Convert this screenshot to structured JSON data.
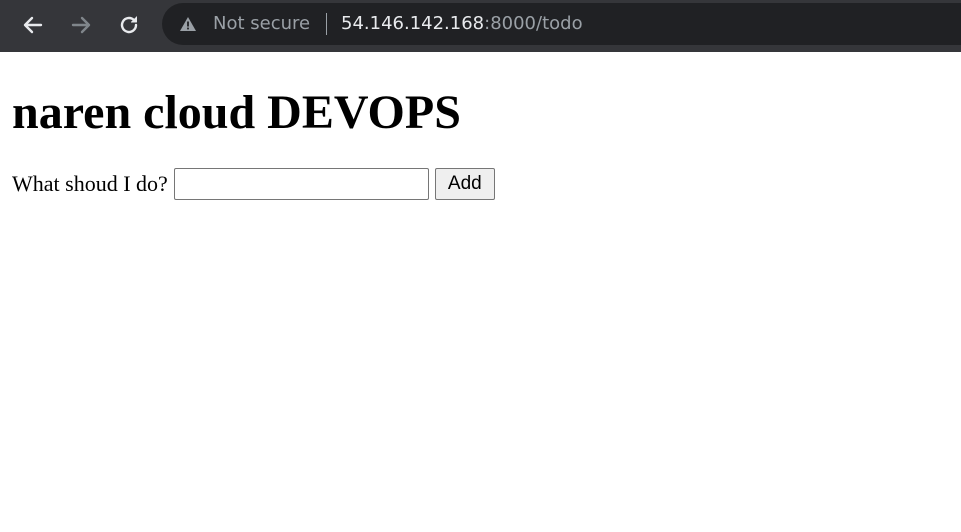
{
  "browser": {
    "security_label": "Not secure",
    "url_host": "54.146.142.168",
    "url_rest": ":8000/todo",
    "icons": {
      "back": "back-arrow-icon",
      "forward": "forward-arrow-icon",
      "reload": "reload-icon",
      "security": "warning-triangle-icon"
    },
    "colors": {
      "toolbar_bg": "#35363a",
      "omnibox_bg": "#202124",
      "url_host": "#e8eaed",
      "url_secondary": "#9aa0a6"
    }
  },
  "page": {
    "title": "naren cloud DEVOPS",
    "form": {
      "label": "What shoud I do?",
      "input_value": "",
      "button_label": "Add"
    }
  }
}
